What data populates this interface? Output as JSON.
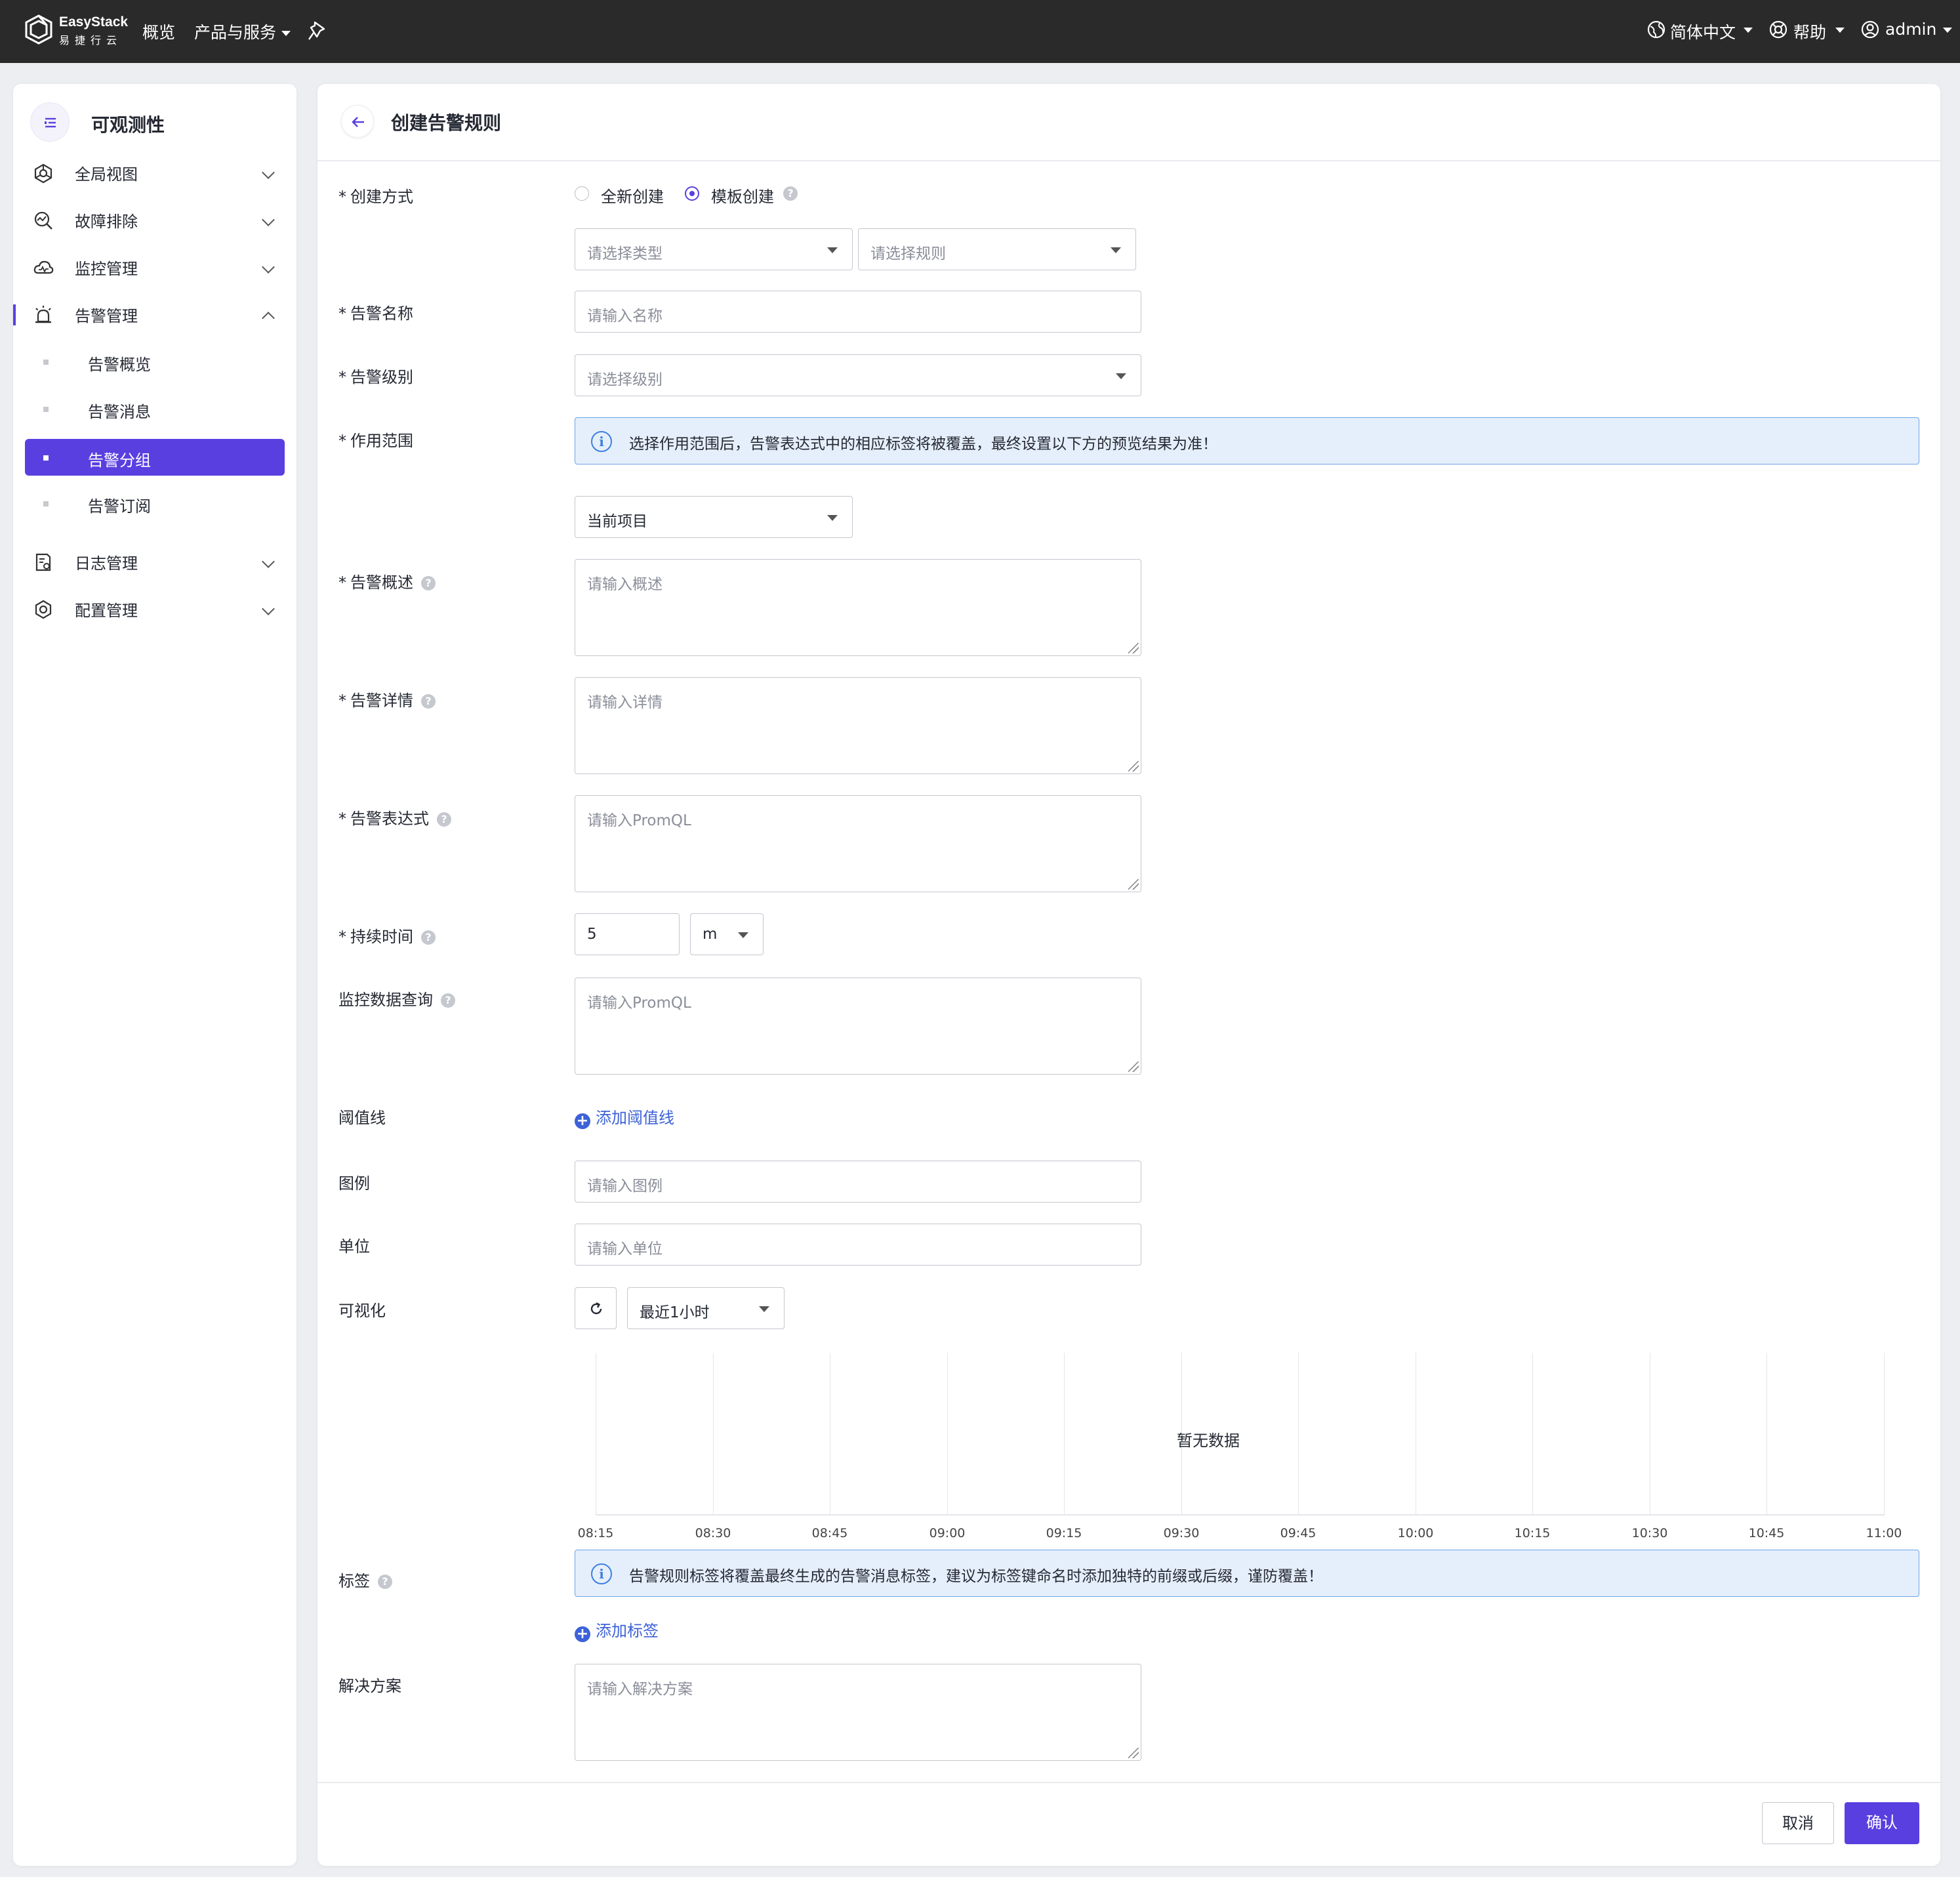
{
  "topbar": {
    "logo_en": "EasyStack",
    "logo_cn": "易捷行云",
    "nav_overview": "概览",
    "nav_products": "产品与服务",
    "language": "简体中文",
    "help": "帮助",
    "user": "admin"
  },
  "sidebar": {
    "title": "可观测性",
    "menu": [
      {
        "label": "全局视图",
        "icon": "hexagon-icon"
      },
      {
        "label": "故障排除",
        "icon": "magnify-chart-icon"
      },
      {
        "label": "监控管理",
        "icon": "cloud-monitor-icon"
      },
      {
        "label": "告警管理",
        "icon": "alarm-icon"
      },
      {
        "label": "日志管理",
        "icon": "log-file-icon"
      },
      {
        "label": "配置管理",
        "icon": "gear-icon"
      }
    ],
    "alarm_sub": [
      {
        "label": "告警概览"
      },
      {
        "label": "告警消息"
      },
      {
        "label": "告警分组"
      },
      {
        "label": "告警订阅"
      }
    ]
  },
  "page": {
    "title": "创建告警规则"
  },
  "form": {
    "create_method_label": "创建方式",
    "create_new": "全新创建",
    "create_template": "模板创建",
    "type_placeholder": "请选择类型",
    "rule_placeholder": "请选择规则",
    "name_label": "告警名称",
    "name_placeholder": "请输入名称",
    "level_label": "告警级别",
    "level_placeholder": "请选择级别",
    "scope_label": "作用范围",
    "scope_info": "选择作用范围后，告警表达式中的相应标签将被覆盖，最终设置以下方的预览结果为准！",
    "scope_value": "当前项目",
    "summary_label": "告警概述",
    "summary_placeholder": "请输入概述",
    "detail_label": "告警详情",
    "detail_placeholder": "请输入详情",
    "expr_label": "告警表达式",
    "expr_placeholder": "请输入PromQL",
    "duration_label": "持续时间",
    "duration_value": "5",
    "duration_unit": "m",
    "query_label": "监控数据查询",
    "query_placeholder": "请输入PromQL",
    "threshold_label": "阈值线",
    "threshold_add": "添加阈值线",
    "legend_label": "图例",
    "legend_placeholder": "请输入图例",
    "unit_label": "单位",
    "unit_placeholder": "请输入单位",
    "viz_label": "可视化",
    "viz_range": "最近1小时",
    "tags_label": "标签",
    "tags_info": "告警规则标签将覆盖最终生成的告警消息标签，建议为标签键命名时添加独特的前缀或后缀，谨防覆盖！",
    "tags_add": "添加标签",
    "solution_label": "解决方案",
    "solution_placeholder": "请输入解决方案",
    "cancel": "取消",
    "confirm": "确认"
  },
  "chart_data": {
    "type": "line",
    "x": [
      "08:15",
      "08:30",
      "08:45",
      "09:00",
      "09:15",
      "09:30",
      "09:45",
      "10:00",
      "10:15",
      "10:30",
      "10:45",
      "11:00"
    ],
    "series": [],
    "empty_text": "暂无数据",
    "grid": true
  }
}
